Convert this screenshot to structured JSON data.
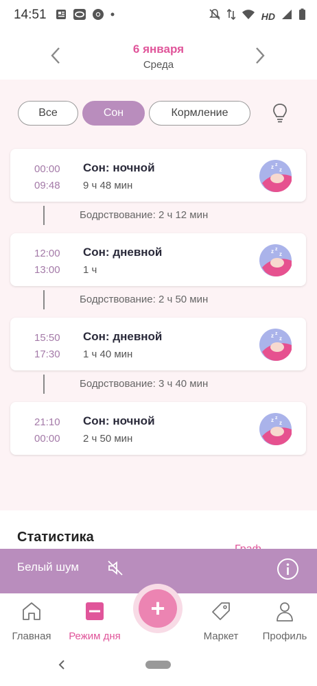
{
  "status_bar": {
    "time": "14:51",
    "network": "HD"
  },
  "header": {
    "date": "6 января",
    "weekday": "Среда"
  },
  "filters": {
    "all": "Все",
    "sleep": "Сон",
    "feeding": "Кормление",
    "active": "sleep"
  },
  "entries": [
    {
      "start": "00:00",
      "end": "09:48",
      "title": "Сон: ночной",
      "duration": "9 ч 48 мин"
    },
    {
      "start": "12:00",
      "end": "13:00",
      "title": "Сон: дневной",
      "duration": "1 ч"
    },
    {
      "start": "15:50",
      "end": "17:30",
      "title": "Сон: дневной",
      "duration": "1 ч 40 мин"
    },
    {
      "start": "21:10",
      "end": "00:00",
      "title": "Сон: ночной",
      "duration": "2 ч 50 мин"
    }
  ],
  "wake_periods": [
    "Бодрствование: 2 ч 12 мин",
    "Бодрствование: 2 ч 50 мин",
    "Бодрствование: 3 ч 40 мин"
  ],
  "stats": {
    "title": "Статистика",
    "link": "Граф"
  },
  "white_noise": {
    "label": "Белый шум"
  },
  "tabs": {
    "home": "Главная",
    "schedule": "Режим дня",
    "market": "Маркет",
    "profile": "Профиль",
    "active": "schedule"
  },
  "colors": {
    "accent": "#e0559a",
    "purple": "#b98dbd",
    "background": "#fdf3f5"
  }
}
